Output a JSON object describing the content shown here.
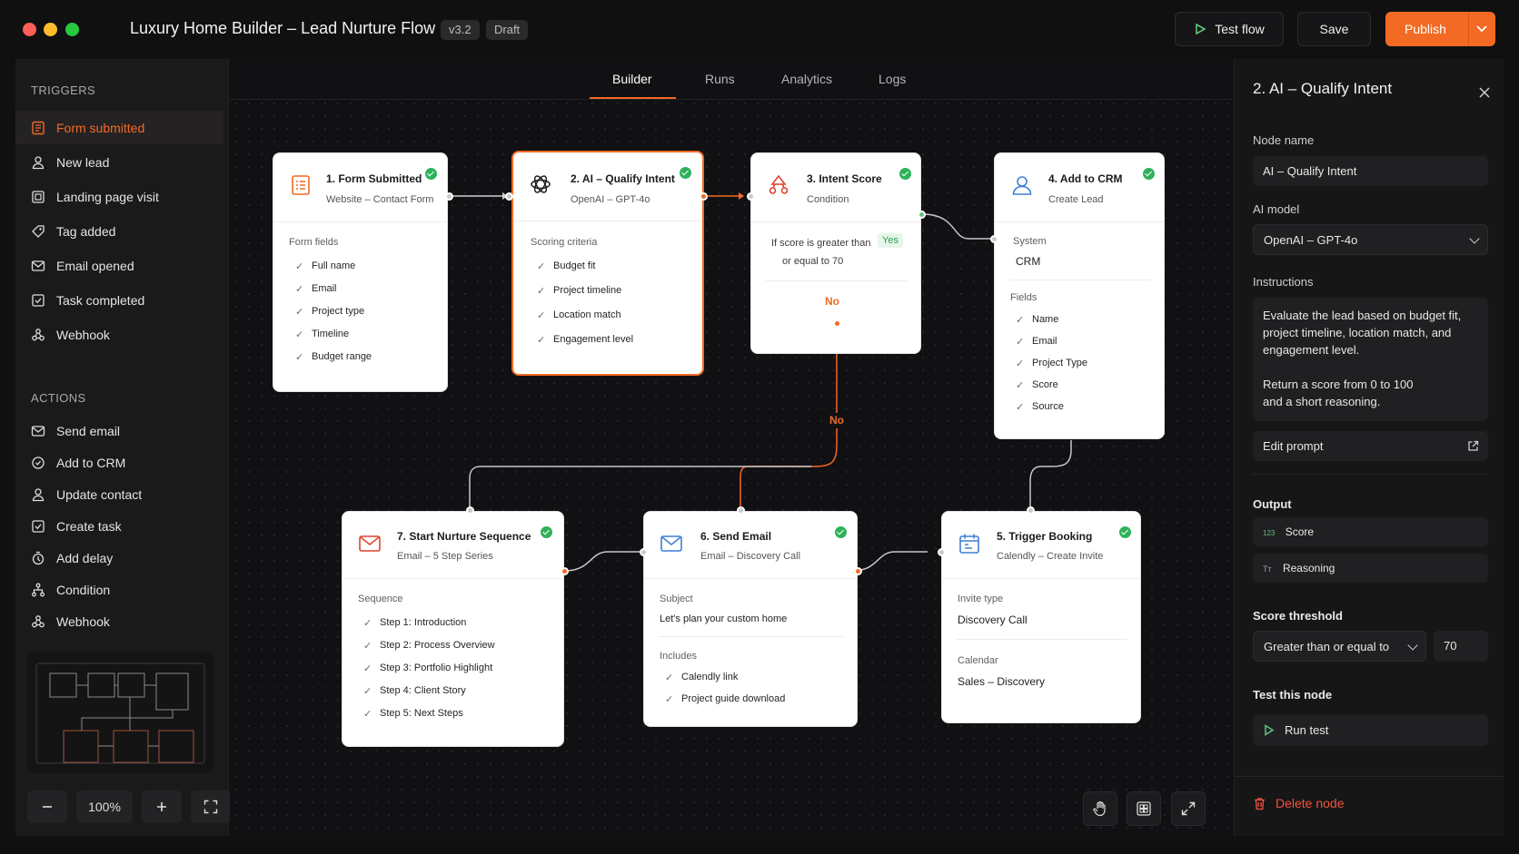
{
  "app": {
    "title": "Luxury Home Builder – Lead Nurture Flow",
    "version": "v3.2",
    "status": "Draft",
    "accent": "#f26a24"
  },
  "toolbar": {
    "test_label": "Test flow",
    "save_label": "Save",
    "publish_label": "Publish"
  },
  "sidebar": {
    "triggers_title": "TRIGGERS",
    "triggers": [
      {
        "label": "Form submitted",
        "icon": "form-icon",
        "active": true
      },
      {
        "label": "New lead",
        "icon": "user-icon"
      },
      {
        "label": "Landing page visit",
        "icon": "page-icon"
      },
      {
        "label": "Tag added",
        "icon": "tag-icon"
      },
      {
        "label": "Email opened",
        "icon": "mail-icon"
      },
      {
        "label": "Task completed",
        "icon": "checkbox-icon"
      },
      {
        "label": "Webhook",
        "icon": "webhook-icon"
      }
    ],
    "actions_title": "ACTIONS",
    "actions": [
      {
        "label": "Send email",
        "icon": "mail-icon"
      },
      {
        "label": "Add to CRM",
        "icon": "crm-icon"
      },
      {
        "label": "Update contact",
        "icon": "user-icon"
      },
      {
        "label": "Create task",
        "icon": "checkbox-icon"
      },
      {
        "label": "Add delay",
        "icon": "timer-icon"
      },
      {
        "label": "Condition",
        "icon": "branch-icon"
      },
      {
        "label": "Webhook",
        "icon": "webhook-icon"
      }
    ],
    "zoom": "100%"
  },
  "tabs": [
    "Builder",
    "Runs",
    "Analytics",
    "Logs"
  ],
  "nodes": {
    "n1": {
      "title": "1. Form Submitted",
      "sub": "Website – Contact Form",
      "section": "Form fields",
      "items": [
        "Full name",
        "Email",
        "Project type",
        "Timeline",
        "Budget range"
      ]
    },
    "n2": {
      "title": "2. AI – Qualify Intent",
      "sub": "OpenAI – GPT-4o",
      "section": "Scoring criteria",
      "items": [
        "Budget fit",
        "Project timeline",
        "Location match",
        "Engagement level"
      ]
    },
    "n3": {
      "title": "3. Intent Score",
      "sub": "Condition",
      "cond1": "If score is greater than",
      "cond2": "or equal to 70",
      "yes": "Yes",
      "no": "No"
    },
    "n4": {
      "title": "4. Add to CRM",
      "sub": "Create Lead",
      "system_label": "System",
      "system": "CRM",
      "fields_label": "Fields",
      "items": [
        "Name",
        "Email",
        "Project Type",
        "Score",
        "Source"
      ]
    },
    "n5": {
      "title": "5. Trigger Booking",
      "sub": "Calendly – Create Invite",
      "invite_label": "Invite type",
      "invite": "Discovery Call",
      "calendar_label": "Calendar",
      "calendar": "Sales – Discovery"
    },
    "n6": {
      "title": "6. Send Email",
      "sub": "Email – Discovery Call",
      "subject_label": "Subject",
      "subject": "Let's plan your custom home",
      "includes_label": "Includes",
      "items": [
        "Calendly link",
        "Project guide download"
      ]
    },
    "n7": {
      "title": "7. Start Nurture Sequence",
      "sub": "Email – 5 Step Series",
      "section": "Sequence",
      "items": [
        "Step 1: Introduction",
        "Step 2: Process Overview",
        "Step 3: Portfolio Highlight",
        "Step 4: Client Story",
        "Step 5: Next Steps"
      ]
    }
  },
  "edge_labels": {
    "no": "No"
  },
  "panel": {
    "title": "2. AI – Qualify Intent",
    "node_name_label": "Node name",
    "node_name": "AI – Qualify Intent",
    "model_label": "AI model",
    "model": "OpenAI – GPT-4o",
    "instructions_label": "Instructions",
    "instr1": "Evaluate the lead based on budget fit,",
    "instr2": "project timeline, location match, and",
    "instr3": "engagement level.",
    "instr4": "Return a score from 0 to 100",
    "instr5": "and a short reasoning.",
    "edit_prompt": "Edit prompt",
    "output_label": "Output",
    "out_score_badge": "123",
    "out_score": "Score",
    "out_reason_badge": "Tт",
    "out_reason": "Reasoning",
    "threshold_label": "Score threshold",
    "threshold_op": "Greater than or equal to",
    "threshold_val": "70",
    "test_label": "Test this node",
    "run_test": "Run test",
    "delete": "Delete node"
  }
}
